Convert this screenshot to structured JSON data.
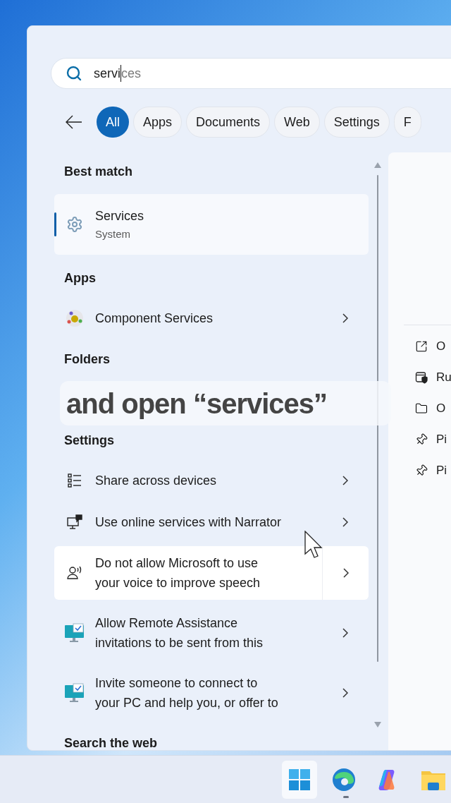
{
  "search": {
    "value": "servi",
    "completion": "ces"
  },
  "filters": [
    {
      "label": "All",
      "selected": true
    },
    {
      "label": "Apps",
      "selected": false
    },
    {
      "label": "Documents",
      "selected": false
    },
    {
      "label": "Web",
      "selected": false
    },
    {
      "label": "Settings",
      "selected": false
    },
    {
      "label": "F",
      "selected": false
    }
  ],
  "sections": [
    {
      "heading": "Best match",
      "items": [
        {
          "kind": "best",
          "title": "Services",
          "subtitle": "System",
          "selected": true
        }
      ]
    },
    {
      "heading": "Apps",
      "items": [
        {
          "kind": "component",
          "title": "Component Services",
          "hovered": false
        }
      ]
    },
    {
      "heading": "Folders"
    },
    {
      "heading": "Settings",
      "items": [
        {
          "kind": "list",
          "title": "Share across devices",
          "hovered": false
        },
        {
          "kind": "narrator",
          "title": "Use online services with Narrator",
          "hovered": false
        },
        {
          "kind": "voice",
          "title": "Do not allow Microsoft to use\nyour voice to improve speech",
          "hovered": true
        },
        {
          "kind": "remote",
          "title": "Allow Remote Assistance\ninvitations to be sent from this",
          "hovered": false
        },
        {
          "kind": "remote",
          "title": "Invite someone to connect to\nyour PC and help you, or offer to",
          "hovered": false
        }
      ]
    },
    {
      "heading": "Search the web"
    }
  ],
  "actions": [
    {
      "kind": "open",
      "label": "O"
    },
    {
      "kind": "admin",
      "label": "Ru"
    },
    {
      "kind": "folder",
      "label": "O"
    },
    {
      "kind": "pin",
      "label": "Pi"
    },
    {
      "kind": "pin",
      "label": "Pi"
    }
  ],
  "caption": "and open “services”",
  "taskbar": [
    {
      "kind": "start",
      "selected": true,
      "running": false
    },
    {
      "kind": "browser",
      "selected": false,
      "running": true
    },
    {
      "kind": "assistant",
      "selected": false,
      "running": false
    },
    {
      "kind": "explorer",
      "selected": false,
      "running": false
    }
  ]
}
